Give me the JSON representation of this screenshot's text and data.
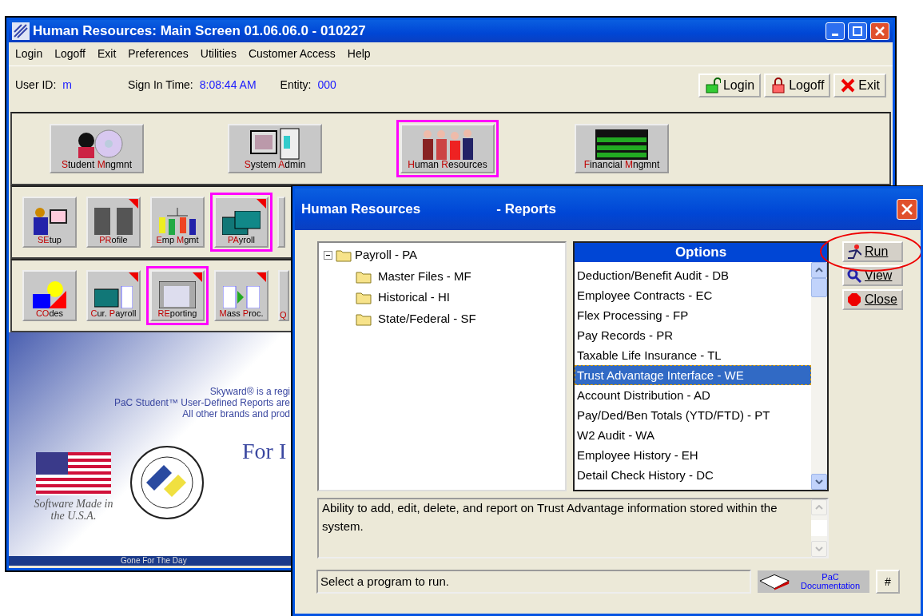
{
  "main_window": {
    "title": "Human Resources: Main Screen 01.06.06.0 - 010227",
    "menu": [
      "Login",
      "Logoff",
      "Exit",
      "Preferences",
      "Utilities",
      "Customer Access",
      "Help"
    ],
    "info": [
      {
        "label": "User ID:",
        "value": "m"
      },
      {
        "label": "Sign In Time:",
        "value": "8:08:44 AM"
      },
      {
        "label": "Entity:",
        "value": "000"
      }
    ],
    "session_buttons": [
      {
        "kind": "login",
        "label": "Login"
      },
      {
        "kind": "logoff",
        "label": "Logoff"
      },
      {
        "kind": "exit",
        "label": "Exit"
      }
    ],
    "modules": [
      {
        "selected": false,
        "label_parts": [
          {
            "text": "S",
            "accent": true
          },
          {
            "text": "tudent ",
            "accent": false
          },
          {
            "text": "M",
            "accent": true
          },
          {
            "text": "ngmnt",
            "accent": false
          }
        ]
      },
      {
        "selected": false,
        "label_parts": [
          {
            "text": "S",
            "accent": true
          },
          {
            "text": "ystem ",
            "accent": false
          },
          {
            "text": "A",
            "accent": true
          },
          {
            "text": "dmin",
            "accent": false
          }
        ]
      },
      {
        "selected": true,
        "label_parts": [
          {
            "text": "H",
            "accent": true
          },
          {
            "text": "uman ",
            "accent": false
          },
          {
            "text": "R",
            "accent": true
          },
          {
            "text": "esources",
            "accent": false
          }
        ]
      },
      {
        "selected": false,
        "label_parts": [
          {
            "text": "F",
            "accent": true
          },
          {
            "text": "inancial ",
            "accent": false
          },
          {
            "text": "M",
            "accent": true
          },
          {
            "text": "ngmnt",
            "accent": false
          }
        ]
      }
    ],
    "submodule_rows": [
      [
        {
          "selected": false,
          "flagged": false,
          "label_parts": [
            {
              "text": "SE",
              "accent": true
            },
            {
              "text": "tup",
              "accent": false
            }
          ]
        },
        {
          "selected": false,
          "flagged": true,
          "label_parts": [
            {
              "text": "PR",
              "accent": true
            },
            {
              "text": "ofile",
              "accent": false
            }
          ]
        },
        {
          "selected": false,
          "flagged": false,
          "label_parts": [
            {
              "text": "E",
              "accent": true
            },
            {
              "text": "mp ",
              "accent": false
            },
            {
              "text": "M",
              "accent": true
            },
            {
              "text": "gmt",
              "accent": false
            }
          ]
        },
        {
          "selected": true,
          "flagged": true,
          "label_parts": [
            {
              "text": "PA",
              "accent": true
            },
            {
              "text": "yroll",
              "accent": false
            }
          ]
        }
      ],
      [
        {
          "selected": false,
          "flagged": false,
          "label_parts": [
            {
              "text": "CO",
              "accent": true
            },
            {
              "text": "des",
              "accent": false
            }
          ]
        },
        {
          "selected": false,
          "flagged": true,
          "label_parts": [
            {
              "text": "C",
              "accent": true
            },
            {
              "text": "ur. ",
              "accent": false
            },
            {
              "text": "P",
              "accent": true
            },
            {
              "text": "ayroll",
              "accent": false
            }
          ]
        },
        {
          "selected": true,
          "flagged": true,
          "label_parts": [
            {
              "text": "RE",
              "accent": true
            },
            {
              "text": "porting",
              "accent": false
            }
          ]
        },
        {
          "selected": false,
          "flagged": true,
          "label_parts": [
            {
              "text": "M",
              "accent": true
            },
            {
              "text": "ass ",
              "accent": false
            },
            {
              "text": "P",
              "accent": true
            },
            {
              "text": "roc.",
              "accent": false
            }
          ]
        },
        {
          "selected": false,
          "flagged": false,
          "label_parts": [
            {
              "text": "Q",
              "accent": true
            }
          ]
        }
      ]
    ],
    "splash": {
      "notices": [
        "Skyward® is a regi",
        "PaC Student™ User-Defined Reports are",
        "All other brands and prod"
      ],
      "headline": "For I",
      "flag_caption": "Software Made in the U.S.A."
    },
    "status_bar": "Gone For The Day"
  },
  "dialog": {
    "title": "Human Resources",
    "subtitle": "- Reports",
    "tree": {
      "label": "Payroll - PA",
      "expanded": true,
      "children": [
        {
          "label": "Master Files - MF"
        },
        {
          "label": "Historical - HI"
        },
        {
          "label": "State/Federal - SF"
        }
      ]
    },
    "options_header": "Options",
    "options": [
      {
        "label": "Deduction/Benefit Audit - DB",
        "selected": false
      },
      {
        "label": "Employee Contracts - EC",
        "selected": false
      },
      {
        "label": "Flex Processing - FP",
        "selected": false
      },
      {
        "label": "Pay Records - PR",
        "selected": false
      },
      {
        "label": "Taxable Life Insurance - TL",
        "selected": false
      },
      {
        "label": "Trust Advantage Interface - WE",
        "selected": true
      },
      {
        "label": "Account Distribution - AD",
        "selected": false
      },
      {
        "label": "Pay/Ded/Ben Totals (YTD/FTD) - PT",
        "selected": false
      },
      {
        "label": "W2 Audit - WA",
        "selected": false
      },
      {
        "label": "Employee History - EH",
        "selected": false
      },
      {
        "label": "Detail Check History - DC",
        "selected": false
      }
    ],
    "buttons": [
      {
        "kind": "run",
        "label": "Run",
        "highlighted": true
      },
      {
        "kind": "view",
        "label": "View",
        "highlighted": false
      },
      {
        "kind": "close",
        "label": "Close",
        "highlighted": false
      }
    ],
    "description": "Ability to add, edit, delete, and report on Trust Advantage information stored within the system.",
    "status": "Select a program to run.",
    "doc_button": "PaC Documentation",
    "hash_button": "#"
  }
}
